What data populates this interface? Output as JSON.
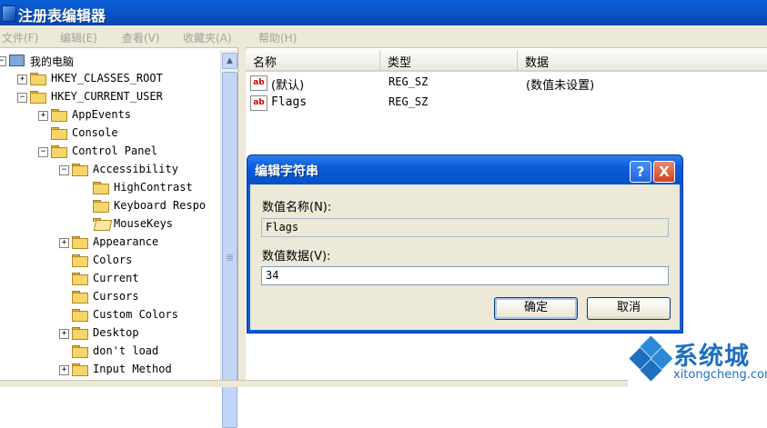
{
  "window": {
    "title": "注册表编辑器"
  },
  "menu": [
    "文件(F)",
    "编辑(E)",
    "查看(V)",
    "收藏夹(A)",
    "帮助(H)"
  ],
  "tree": [
    {
      "label": "我的电脑",
      "level": 0,
      "expander": "-",
      "icon": "computer"
    },
    {
      "label": "HKEY_CLASSES_ROOT",
      "level": 1,
      "expander": "+"
    },
    {
      "label": "HKEY_CURRENT_USER",
      "level": 1,
      "expander": "-"
    },
    {
      "label": "AppEvents",
      "level": 2,
      "expander": "+"
    },
    {
      "label": "Console",
      "level": 2,
      "expander": ""
    },
    {
      "label": "Control Panel",
      "level": 2,
      "expander": "-"
    },
    {
      "label": "Accessibility",
      "level": 3,
      "expander": "-"
    },
    {
      "label": "HighContrast",
      "level": 4,
      "expander": ""
    },
    {
      "label": "Keyboard Respo",
      "level": 4,
      "expander": ""
    },
    {
      "label": "MouseKeys",
      "level": 4,
      "expander": "",
      "open": true
    },
    {
      "label": "Appearance",
      "level": 3,
      "expander": "+"
    },
    {
      "label": "Colors",
      "level": 3,
      "expander": ""
    },
    {
      "label": "Current",
      "level": 3,
      "expander": ""
    },
    {
      "label": "Cursors",
      "level": 3,
      "expander": ""
    },
    {
      "label": "Custom Colors",
      "level": 3,
      "expander": ""
    },
    {
      "label": "Desktop",
      "level": 3,
      "expander": "+"
    },
    {
      "label": "don't load",
      "level": 3,
      "expander": ""
    },
    {
      "label": "Input Method",
      "level": 3,
      "expander": "+"
    }
  ],
  "list": {
    "columns": [
      "名称",
      "类型",
      "数据"
    ],
    "rows": [
      {
        "name": "(默认)",
        "type": "REG_SZ",
        "data": "(数值未设置)"
      },
      {
        "name": "Flags",
        "type": "REG_SZ",
        "data": ""
      }
    ]
  },
  "dialog": {
    "title": "编辑字符串",
    "help_glyph": "?",
    "close_glyph": "X",
    "name_label": "数值名称(N):",
    "name_value": "Flags",
    "data_label": "数值数据(V):",
    "data_value": "34",
    "ok": "确定",
    "cancel": "取消"
  },
  "watermark": {
    "brand": "系统城",
    "url": "xitongcheng.com"
  },
  "colors": {
    "title_blue": "#0b55c8",
    "chrome": "#ece9d8",
    "watermark": "#1f6fc0"
  }
}
